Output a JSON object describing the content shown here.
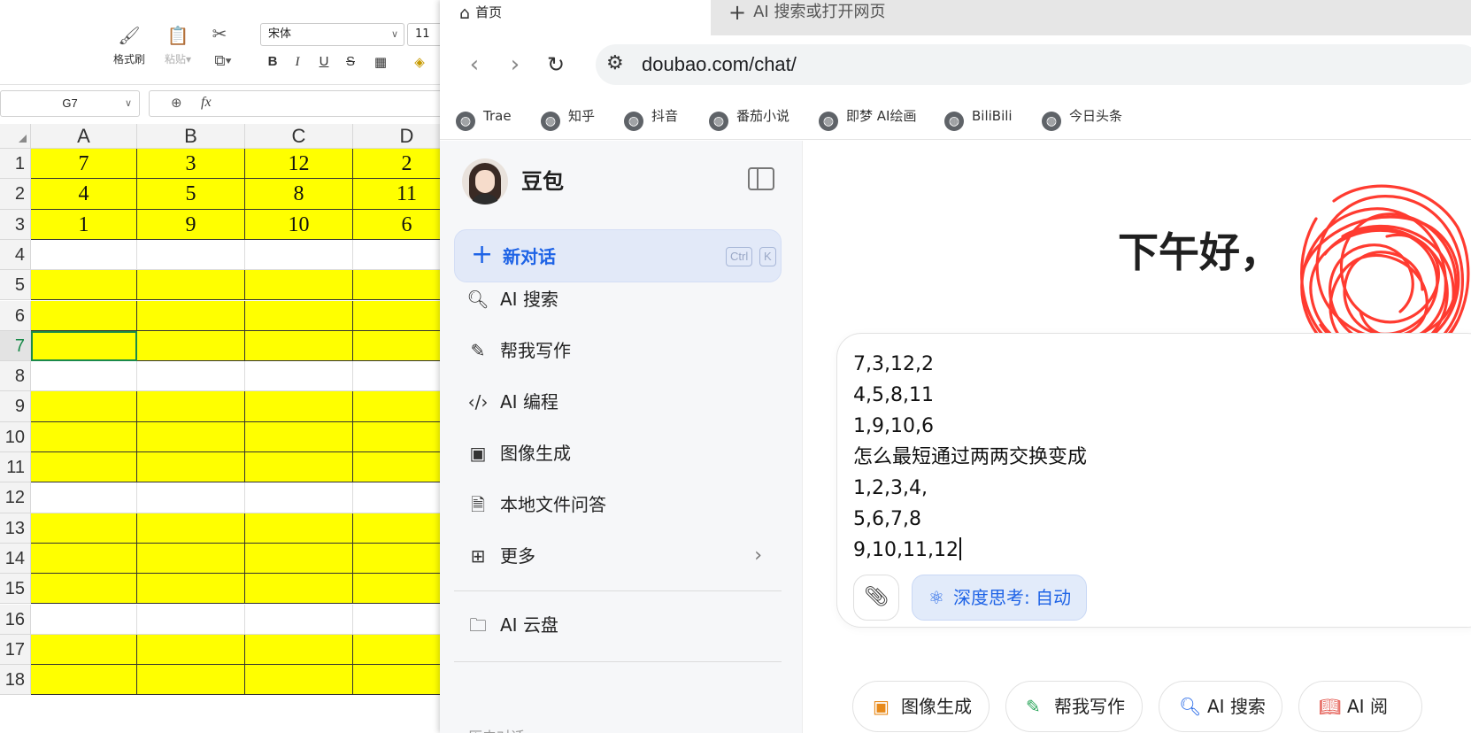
{
  "sheet": {
    "ribbon": {
      "format_painter": "格式刷",
      "paste": "粘贴",
      "font_name": "宋体",
      "font_size": "11",
      "bold": "B",
      "italic": "I",
      "underline": "U",
      "strike": "S"
    },
    "name_box": "G7",
    "fx": "fx",
    "columns": [
      "A",
      "B",
      "C",
      "D"
    ],
    "rows": [
      {
        "num": "1",
        "fill": "yellow",
        "cells": [
          "7",
          "3",
          "12",
          "2"
        ]
      },
      {
        "num": "2",
        "fill": "yellow",
        "cells": [
          "4",
          "5",
          "8",
          "11"
        ]
      },
      {
        "num": "3",
        "fill": "yellow",
        "cells": [
          "1",
          "9",
          "10",
          "6"
        ]
      },
      {
        "num": "4",
        "fill": "white",
        "cells": [
          "",
          "",
          "",
          ""
        ]
      },
      {
        "num": "5",
        "fill": "yellow",
        "cells": [
          "",
          "",
          "",
          ""
        ]
      },
      {
        "num": "6",
        "fill": "yellow",
        "cells": [
          "",
          "",
          "",
          ""
        ]
      },
      {
        "num": "7",
        "fill": "yellow",
        "cells": [
          "",
          "",
          "",
          ""
        ],
        "active": true
      },
      {
        "num": "8",
        "fill": "white",
        "cells": [
          "",
          "",
          "",
          ""
        ]
      },
      {
        "num": "9",
        "fill": "yellow",
        "cells": [
          "",
          "",
          "",
          ""
        ]
      },
      {
        "num": "10",
        "fill": "yellow",
        "cells": [
          "",
          "",
          "",
          ""
        ]
      },
      {
        "num": "11",
        "fill": "yellow",
        "cells": [
          "",
          "",
          "",
          ""
        ]
      },
      {
        "num": "12",
        "fill": "white",
        "cells": [
          "",
          "",
          "",
          ""
        ]
      },
      {
        "num": "13",
        "fill": "yellow",
        "cells": [
          "",
          "",
          "",
          ""
        ]
      },
      {
        "num": "14",
        "fill": "yellow",
        "cells": [
          "",
          "",
          "",
          ""
        ]
      },
      {
        "num": "15",
        "fill": "yellow",
        "cells": [
          "",
          "",
          "",
          ""
        ]
      },
      {
        "num": "16",
        "fill": "white",
        "cells": [
          "",
          "",
          "",
          ""
        ]
      },
      {
        "num": "17",
        "fill": "yellow",
        "cells": [
          "",
          "",
          "",
          ""
        ]
      },
      {
        "num": "18",
        "fill": "yellow",
        "cells": [
          "",
          "",
          "",
          ""
        ]
      }
    ],
    "colors": {
      "yellow": "#ffff00",
      "selection": "#1a8a4a"
    }
  },
  "browser": {
    "tab_active": "首页",
    "tab_new": "AI 搜索或打开网页",
    "url": "doubao.com/chat/",
    "bookmarks": [
      "Trae",
      "知乎",
      "抖音",
      "番茄小说",
      "即梦 AI绘画",
      "BiliBili",
      "今日头条"
    ]
  },
  "app": {
    "name": "豆包",
    "new_chat": "新对话",
    "shortcut": [
      "Ctrl",
      "K"
    ],
    "nav": [
      {
        "icon": "ai-search-icon",
        "label": "AI 搜索"
      },
      {
        "icon": "pen-icon",
        "label": "帮我写作"
      },
      {
        "icon": "code-icon",
        "label": "AI 编程"
      },
      {
        "icon": "image-icon",
        "label": "图像生成"
      },
      {
        "icon": "file-qa-icon",
        "label": "本地文件问答"
      },
      {
        "icon": "grid-icon",
        "label": "更多"
      }
    ],
    "cloud": "AI 云盘",
    "history_label": "历史对话",
    "greeting": "下午好，",
    "prompt_lines": [
      "7,3,12,2",
      "4,5,8,11",
      "1,9,10,6",
      "怎么最短通过两两交换变成",
      "1,2,3,4,",
      "5,6,7,8",
      "9,10,11,12"
    ],
    "deep_think": "深度思考: 自动",
    "chips": [
      "图像生成",
      "帮我写作",
      "AI 搜索",
      "AI 阅"
    ],
    "accent": "#1e63e6"
  }
}
